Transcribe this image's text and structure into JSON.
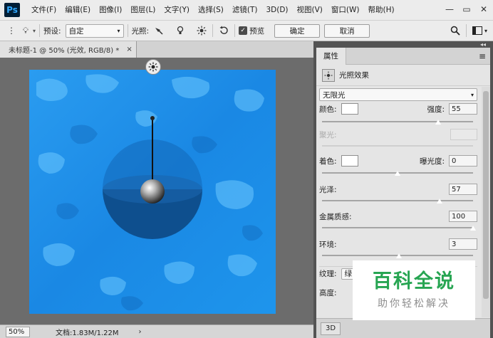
{
  "app": {
    "logo": "Ps"
  },
  "menu": [
    "文件(F)",
    "编辑(E)",
    "图像(I)",
    "图层(L)",
    "文字(Y)",
    "选择(S)",
    "滤镜(T)",
    "3D(D)",
    "视图(V)",
    "窗口(W)",
    "帮助(H)"
  ],
  "window_controls": {
    "minimize": "—",
    "restore": "▭",
    "close": "✕"
  },
  "options": {
    "preset_label": "预设:",
    "preset_value": "自定",
    "light_label": "光照:",
    "preview_label": "预览",
    "ok_label": "确定",
    "cancel_label": "取消"
  },
  "document": {
    "tab_title": "未标题-1 @ 50% (光效, RGB/8) *",
    "close": "×"
  },
  "status": {
    "zoom": "50%",
    "doc_info": "文档:1.83M/1.22M",
    "arrow": "›"
  },
  "properties": {
    "tab": "属性",
    "effect_name": "光照效果",
    "light_type": "无限光",
    "color_label": "颜色:",
    "intensity_label": "强度:",
    "intensity_value": "55",
    "hotspot_label": "聚光:",
    "coloring_label": "着色:",
    "exposure_label": "曝光度:",
    "exposure_value": "0",
    "gloss_label": "光泽:",
    "gloss_value": "57",
    "metallic_label": "金属质感:",
    "metallic_value": "100",
    "ambience_label": "环境:",
    "ambience_value": "3",
    "texture_label": "纹理:",
    "texture_value": "绿",
    "height_label": "高度:",
    "bottom_button": "3D",
    "levels": {
      "intensity": 0.77,
      "exposure": 0.5,
      "gloss": 0.78,
      "metallic": 1.0,
      "ambience": 0.51
    }
  },
  "watermark": {
    "title": "百科全说",
    "subtitle": "助你轻松解决"
  },
  "colors": {
    "canvas_blue": "#1d8fe8",
    "watermark_green": "#27a552"
  }
}
